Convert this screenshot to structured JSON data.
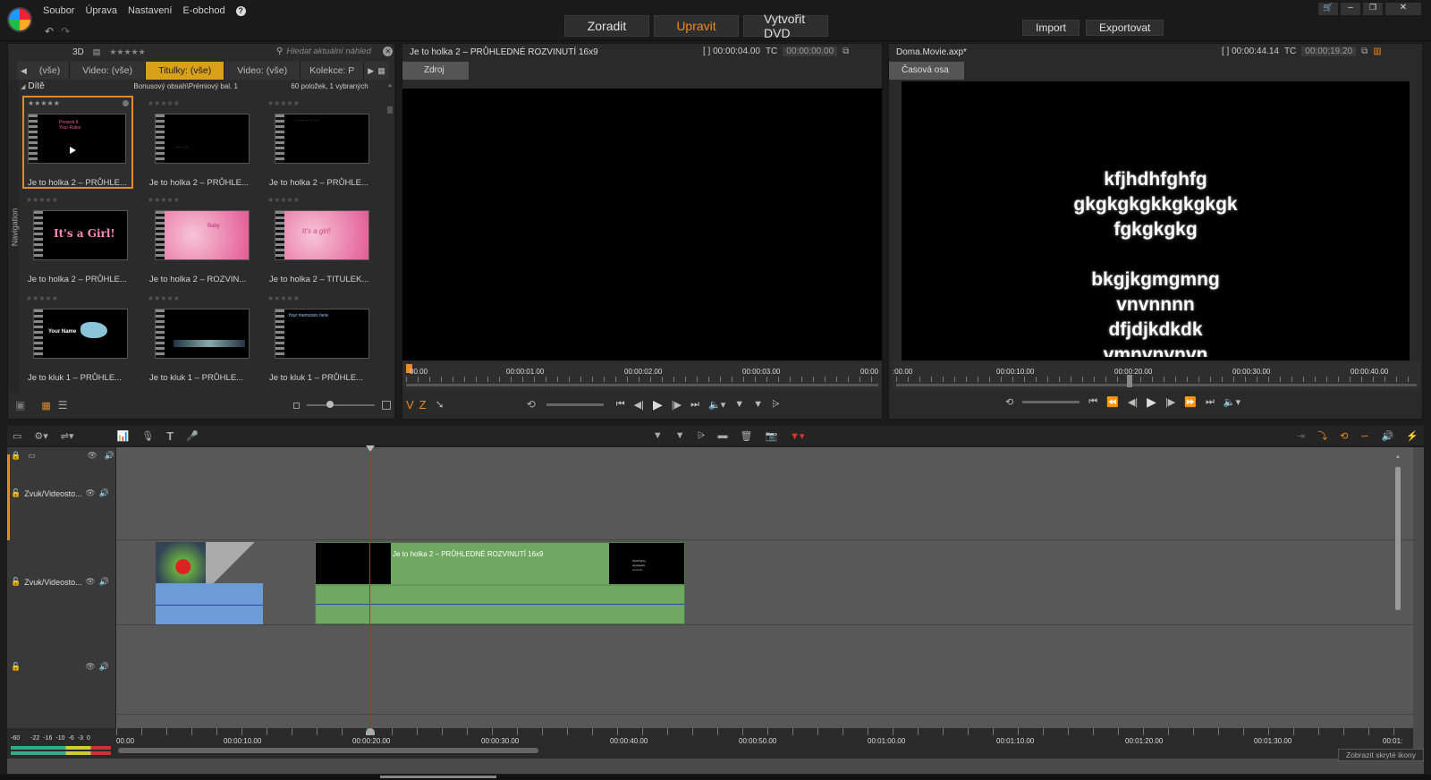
{
  "menu": [
    "Soubor",
    "Úprava",
    "Nastavení",
    "E-obchod"
  ],
  "help_icon": "question-icon",
  "main_tabs": [
    {
      "label": "Zoradit"
    },
    {
      "label": "Upravit"
    },
    {
      "label": "Vytvořit DVD"
    }
  ],
  "active_tab": "Upravit",
  "actions": {
    "import": "Import",
    "export": "Exportovat"
  },
  "library": {
    "view_3d": "3D",
    "rating": "★★★★★",
    "search_placeholder": "Hledat aktuální náhled",
    "tabs": [
      "(vše)",
      "Video: (vše)",
      "Titulky: (vše)",
      "Video: (vše)",
      "Kolekce: P"
    ],
    "active_tab_index": 2,
    "nav_label": "Navigation",
    "folder": "Dítě",
    "path": "Bonusový obsah\\Prémiový bal. 1",
    "count": "60 položek, 1 vybraných",
    "items": [
      {
        "caption": "Je to holka 2 – PRŮHLE...",
        "thumb_text": "Present It Your Rules"
      },
      {
        "caption": "Je to holka 2 – PRŮHLE...",
        "thumb_text": ""
      },
      {
        "caption": "Je to holka 2 – PRŮHLE...",
        "thumb_text": ""
      },
      {
        "caption": "Je to holka 2 – PRŮHLE...",
        "thumb_text": "It's a Girl!"
      },
      {
        "caption": "Je to holka 2 – ROZVIN...",
        "thumb_text": "Baby"
      },
      {
        "caption": "Je to holka 2 – TITULEK...",
        "thumb_text": "It's a girl!"
      },
      {
        "caption": "Je to kluk 1 – PRŮHLE...",
        "thumb_text": "Your Name"
      },
      {
        "caption": "Je to kluk 1 – PRŮHLE...",
        "thumb_text": ""
      },
      {
        "caption": "Je to kluk 1 – PRŮHLE...",
        "thumb_text": "Your memories here"
      }
    ]
  },
  "source_player": {
    "title": "Je to holka 2 – PRŮHLEDNÉ ROZVINUTÍ 16x9",
    "duration": "[ ] 00:00:04.00",
    "tc_label": "TC",
    "tc": "00:00:00.00",
    "tab": "Zdroj",
    "ruler": [
      "00.00",
      "00:00:01.00",
      "00:00:02.00",
      "00:00:03.00",
      "00:00"
    ],
    "mark_in": "V",
    "mark_out": "Z"
  },
  "timeline_player": {
    "title": "Doma.Movie.axp*",
    "duration": "[ ] 00:00:44.14",
    "tc_label": "TC",
    "tc": "00:00:19.20",
    "tab": "Časová osa",
    "preview_lines": [
      "kfjhdhfghfg",
      "gkgkgkgkkgkgkgk",
      "fgkgkgkg",
      "",
      "bkgjkgmgmng",
      "vnvnnnn",
      "dfjdjkdkdk",
      "vmnvnvnvn"
    ],
    "ruler": [
      ":00.00",
      "00:00:10.00",
      "00:00:20.00",
      "00:00:30.00",
      "00:00:40.00"
    ]
  },
  "timeline": {
    "tracks": [
      {
        "name": "Zvuk/Videosto..."
      },
      {
        "name": "Zvuk/Videosto..."
      },
      {
        "name": ""
      }
    ],
    "clip_label": "Je to holka 2 – PRŮHLEDNÉ ROZVINUTÍ 16x9",
    "ruler": [
      "00.00",
      "00:00:10.00",
      "00:00:20.00",
      "00:00:30.00",
      "00:00:40.00",
      "00:00:50.00",
      "00:01:00.00",
      "00:01:10.00",
      "00:01:20.00",
      "00:01:30.00",
      "00:01:"
    ],
    "meter_labels": [
      "-60",
      "-22",
      "-16",
      "-10",
      "-6",
      "-3",
      "0"
    ],
    "show_hidden": "Zobrazit skryté ikony"
  },
  "colors": {
    "accent": "#f08a1c",
    "tab_active": "#d9a11a",
    "clip_green": "#6fa860",
    "playhead": "#d02020"
  }
}
